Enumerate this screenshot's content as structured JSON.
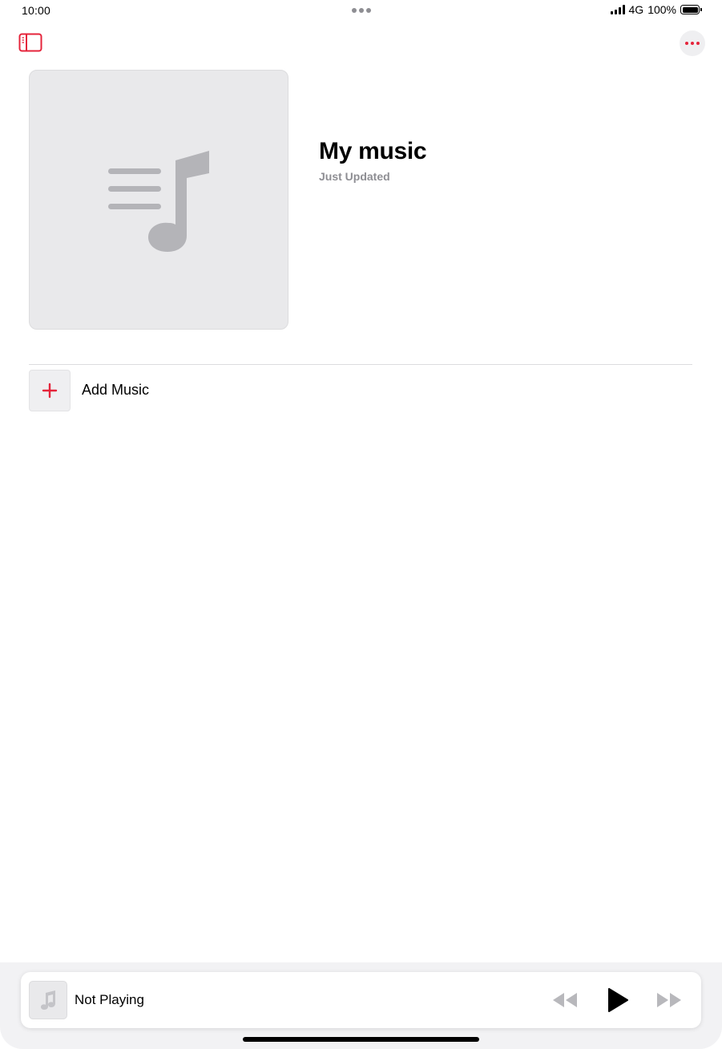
{
  "status_bar": {
    "time": "10:00",
    "network": "4G",
    "battery": "100%"
  },
  "nav": {
    "sidebar_icon": "sidebar-toggle-icon",
    "more_icon": "ellipsis-icon"
  },
  "playlist": {
    "title": "My music",
    "subtitle": "Just Updated",
    "artwork_icon": "music-note-list-icon"
  },
  "actions": {
    "add_music_label": "Add Music",
    "add_icon": "plus-icon"
  },
  "mini_player": {
    "title": "Not Playing",
    "rewind_icon": "rewind-icon",
    "play_icon": "play-icon",
    "forward_icon": "fast-forward-icon"
  },
  "colors": {
    "accent": "#e5243b",
    "secondary_text": "#8e8e93",
    "artwork_bg": "#e9e9eb",
    "disabled_control": "#b8b8bc"
  }
}
